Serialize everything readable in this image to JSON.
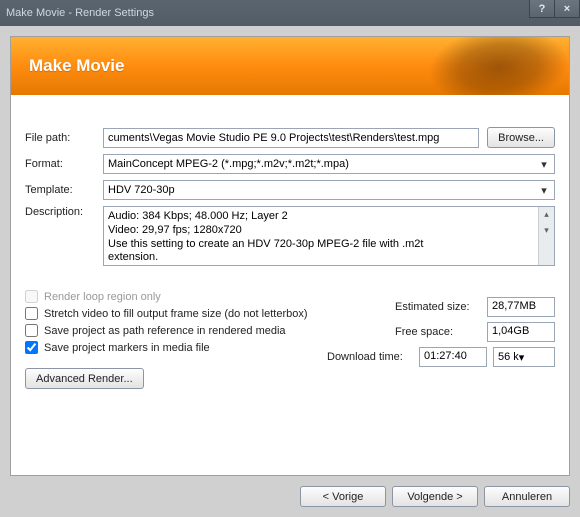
{
  "window": {
    "title": "Make Movie - Render Settings",
    "help": "?",
    "close": "×"
  },
  "header": {
    "title": "Make Movie"
  },
  "labels": {
    "filepath": "File path:",
    "format": "Format:",
    "template": "Template:",
    "description": "Description:",
    "browse": "Browse...",
    "advanced": "Advanced Render..."
  },
  "values": {
    "filepath": "cuments\\Vegas Movie Studio PE 9.0 Projects\\test\\Renders\\test.mpg",
    "format": "MainConcept MPEG-2 (*.mpg;*.m2v;*.m2t;*.mpa)",
    "template": "HDV 720-30p",
    "desc_line1": "Audio: 384 Kbps; 48.000 Hz; Layer 2",
    "desc_line2": "Video: 29,97 fps; 1280x720",
    "desc_line3": "Use this setting to create an HDV 720-30p MPEG-2 file with .m2t",
    "desc_line4": "extension."
  },
  "checks": {
    "loop": "Render loop region only",
    "stretch": "Stretch video to fill output frame size (do not letterbox)",
    "pathref": "Save project as path reference in rendered media",
    "markers": "Save project markers in media file"
  },
  "stats": {
    "est_label": "Estimated size:",
    "est_value": "28,77MB",
    "free_label": "Free space:",
    "free_value": "1,04GB",
    "dl_label": "Download time:",
    "dl_value": "01:27:40",
    "speed": "56 k"
  },
  "buttons": {
    "prev": "< Vorige",
    "next": "Volgende >",
    "cancel": "Annuleren"
  }
}
